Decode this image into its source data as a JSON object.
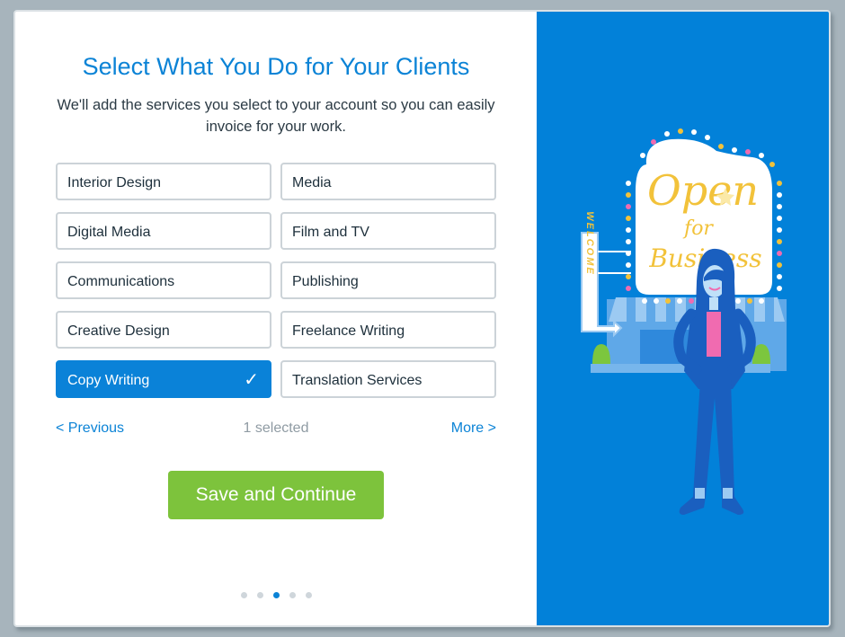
{
  "dialog": {
    "title": "Select What You Do for Your Clients",
    "subtitle": "We'll add the services you select to your account so you can easily invoice for your work."
  },
  "options": [
    {
      "label": "Interior Design",
      "selected": false
    },
    {
      "label": "Media",
      "selected": false
    },
    {
      "label": "Digital Media",
      "selected": false
    },
    {
      "label": "Film and TV",
      "selected": false
    },
    {
      "label": "Communications",
      "selected": false
    },
    {
      "label": "Publishing",
      "selected": false
    },
    {
      "label": "Creative Design",
      "selected": false
    },
    {
      "label": "Freelance Writing",
      "selected": false
    },
    {
      "label": "Copy Writing",
      "selected": true
    },
    {
      "label": "Translation Services",
      "selected": false
    }
  ],
  "check_glyph": "✓",
  "nav": {
    "previous_label": "< Previous",
    "selected_count": "1 selected",
    "more_label": "More >"
  },
  "save_label": "Save and Continue",
  "pagination": {
    "total": 5,
    "current": 3
  },
  "illustration": {
    "sign_text_1": "Open",
    "sign_text_2": "for",
    "sign_text_3": "Business",
    "welcome_text": "WELCOME"
  },
  "colors": {
    "accent": "#0b83d6",
    "selected_bg": "#0a82d8",
    "save_green": "#7dc33c",
    "panel_blue": "#0281d9",
    "sign_yellow": "#f2c23a",
    "pink": "#f06bb0"
  }
}
